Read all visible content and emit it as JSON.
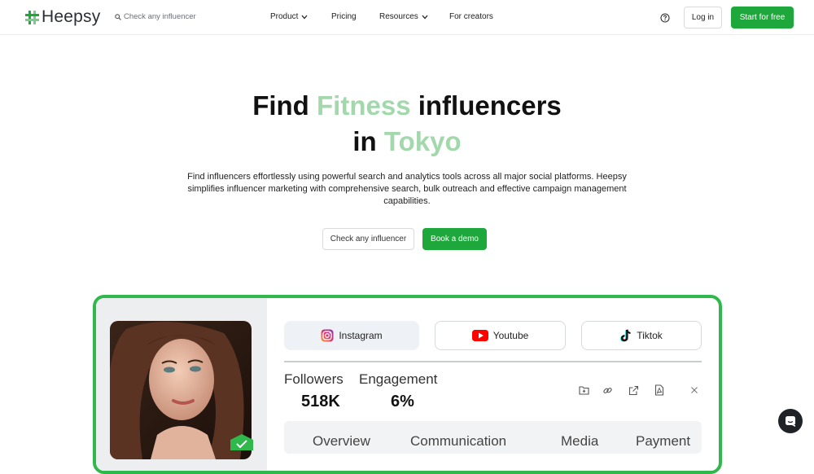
{
  "brand": {
    "name": "Heepsy",
    "accent": "#1ea83c",
    "highlight": "#a3d8ac"
  },
  "header": {
    "search_placeholder": "Check any influencer",
    "nav": [
      {
        "label": "Product",
        "has_dropdown": true
      },
      {
        "label": "Pricing",
        "has_dropdown": false
      },
      {
        "label": "Resources",
        "has_dropdown": true
      },
      {
        "label": "For creators",
        "has_dropdown": false
      }
    ],
    "login_label": "Log in",
    "start_label": "Start for free"
  },
  "hero": {
    "line1_a": "Find ",
    "line1_accent": "Fitness",
    "line1_b": " influencers",
    "line2_a": "in ",
    "line2_accent": "Tokyo",
    "description": "Find influencers effortlessly using powerful search and analytics tools across all major social platforms. Heepsy simplifies influencer marketing with comprehensive search, bulk outreach and effective campaign management capabilities.",
    "check_button": "Check any influencer",
    "demo_button": "Book a demo"
  },
  "profile_card": {
    "platform_tabs": [
      {
        "label": "Instagram",
        "icon": "instagram-icon",
        "active": true
      },
      {
        "label": "Youtube",
        "icon": "youtube-icon",
        "active": false
      },
      {
        "label": "Tiktok",
        "icon": "tiktok-icon",
        "active": false
      }
    ],
    "stats": [
      {
        "label": "Followers",
        "value": "518K"
      },
      {
        "label": "Engagement",
        "value": "6%"
      }
    ],
    "actions": [
      "add-to-folder-icon",
      "link-icon",
      "external-link-icon",
      "pdf-icon",
      "close-icon"
    ],
    "section_tabs": [
      "Overview",
      "Communication",
      "Media",
      "Payment"
    ]
  }
}
